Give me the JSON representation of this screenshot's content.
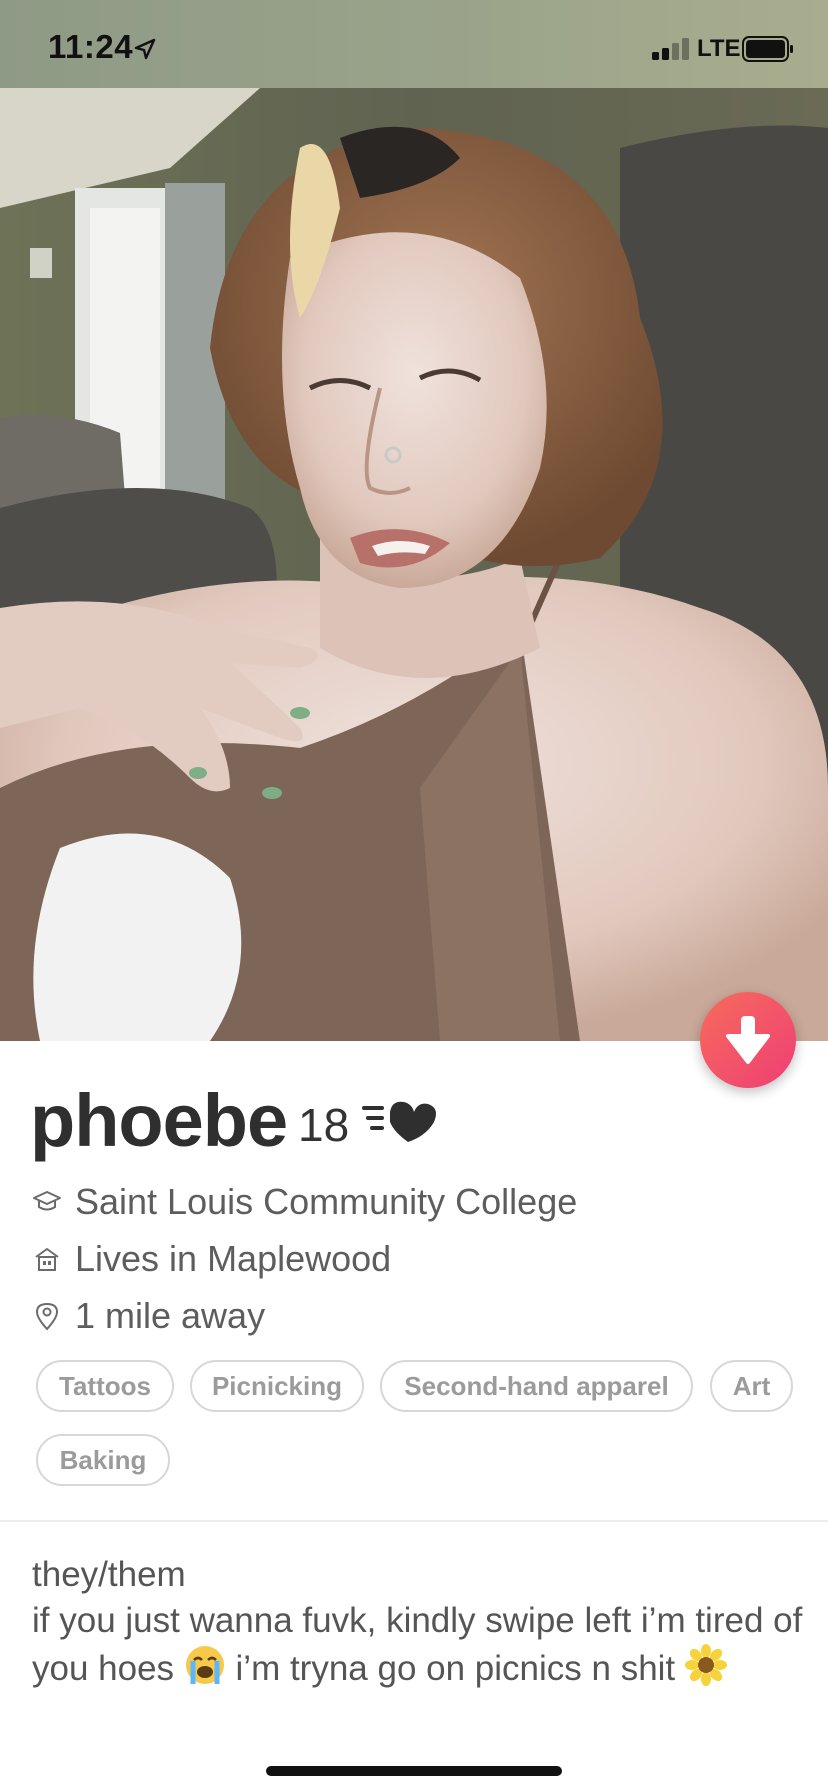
{
  "status_bar": {
    "time": "11:24",
    "network": "LTE",
    "icons": [
      "location-arrow-icon",
      "signal-icon",
      "battery-icon"
    ]
  },
  "photo": {
    "alt": "profile photo"
  },
  "actions": {
    "collapse_icon": "arrow-down-icon",
    "accent_gradient": [
      "#f76b5c",
      "#ee3f74"
    ]
  },
  "profile": {
    "name": "phoebe",
    "age": "18",
    "badge_icon": "speed-heart-icon",
    "details": [
      {
        "icon": "graduation-cap-icon",
        "text": "Saint Louis Community College"
      },
      {
        "icon": "home-icon",
        "text": "Lives in Maplewood"
      },
      {
        "icon": "location-pin-icon",
        "text": "1 mile away"
      }
    ],
    "interests": [
      "Tattoos",
      "Picnicking",
      "Second-hand apparel",
      "Art",
      "Baking"
    ]
  },
  "bio": {
    "line1": "they/them",
    "line2": "if you just wanna fuvk, kindly swipe left i’m tired of you hoes",
    "line3": " i’m tryna go on picnics n shit ",
    "emojis": [
      "crying-face-emoji",
      "sunflower-emoji"
    ]
  }
}
